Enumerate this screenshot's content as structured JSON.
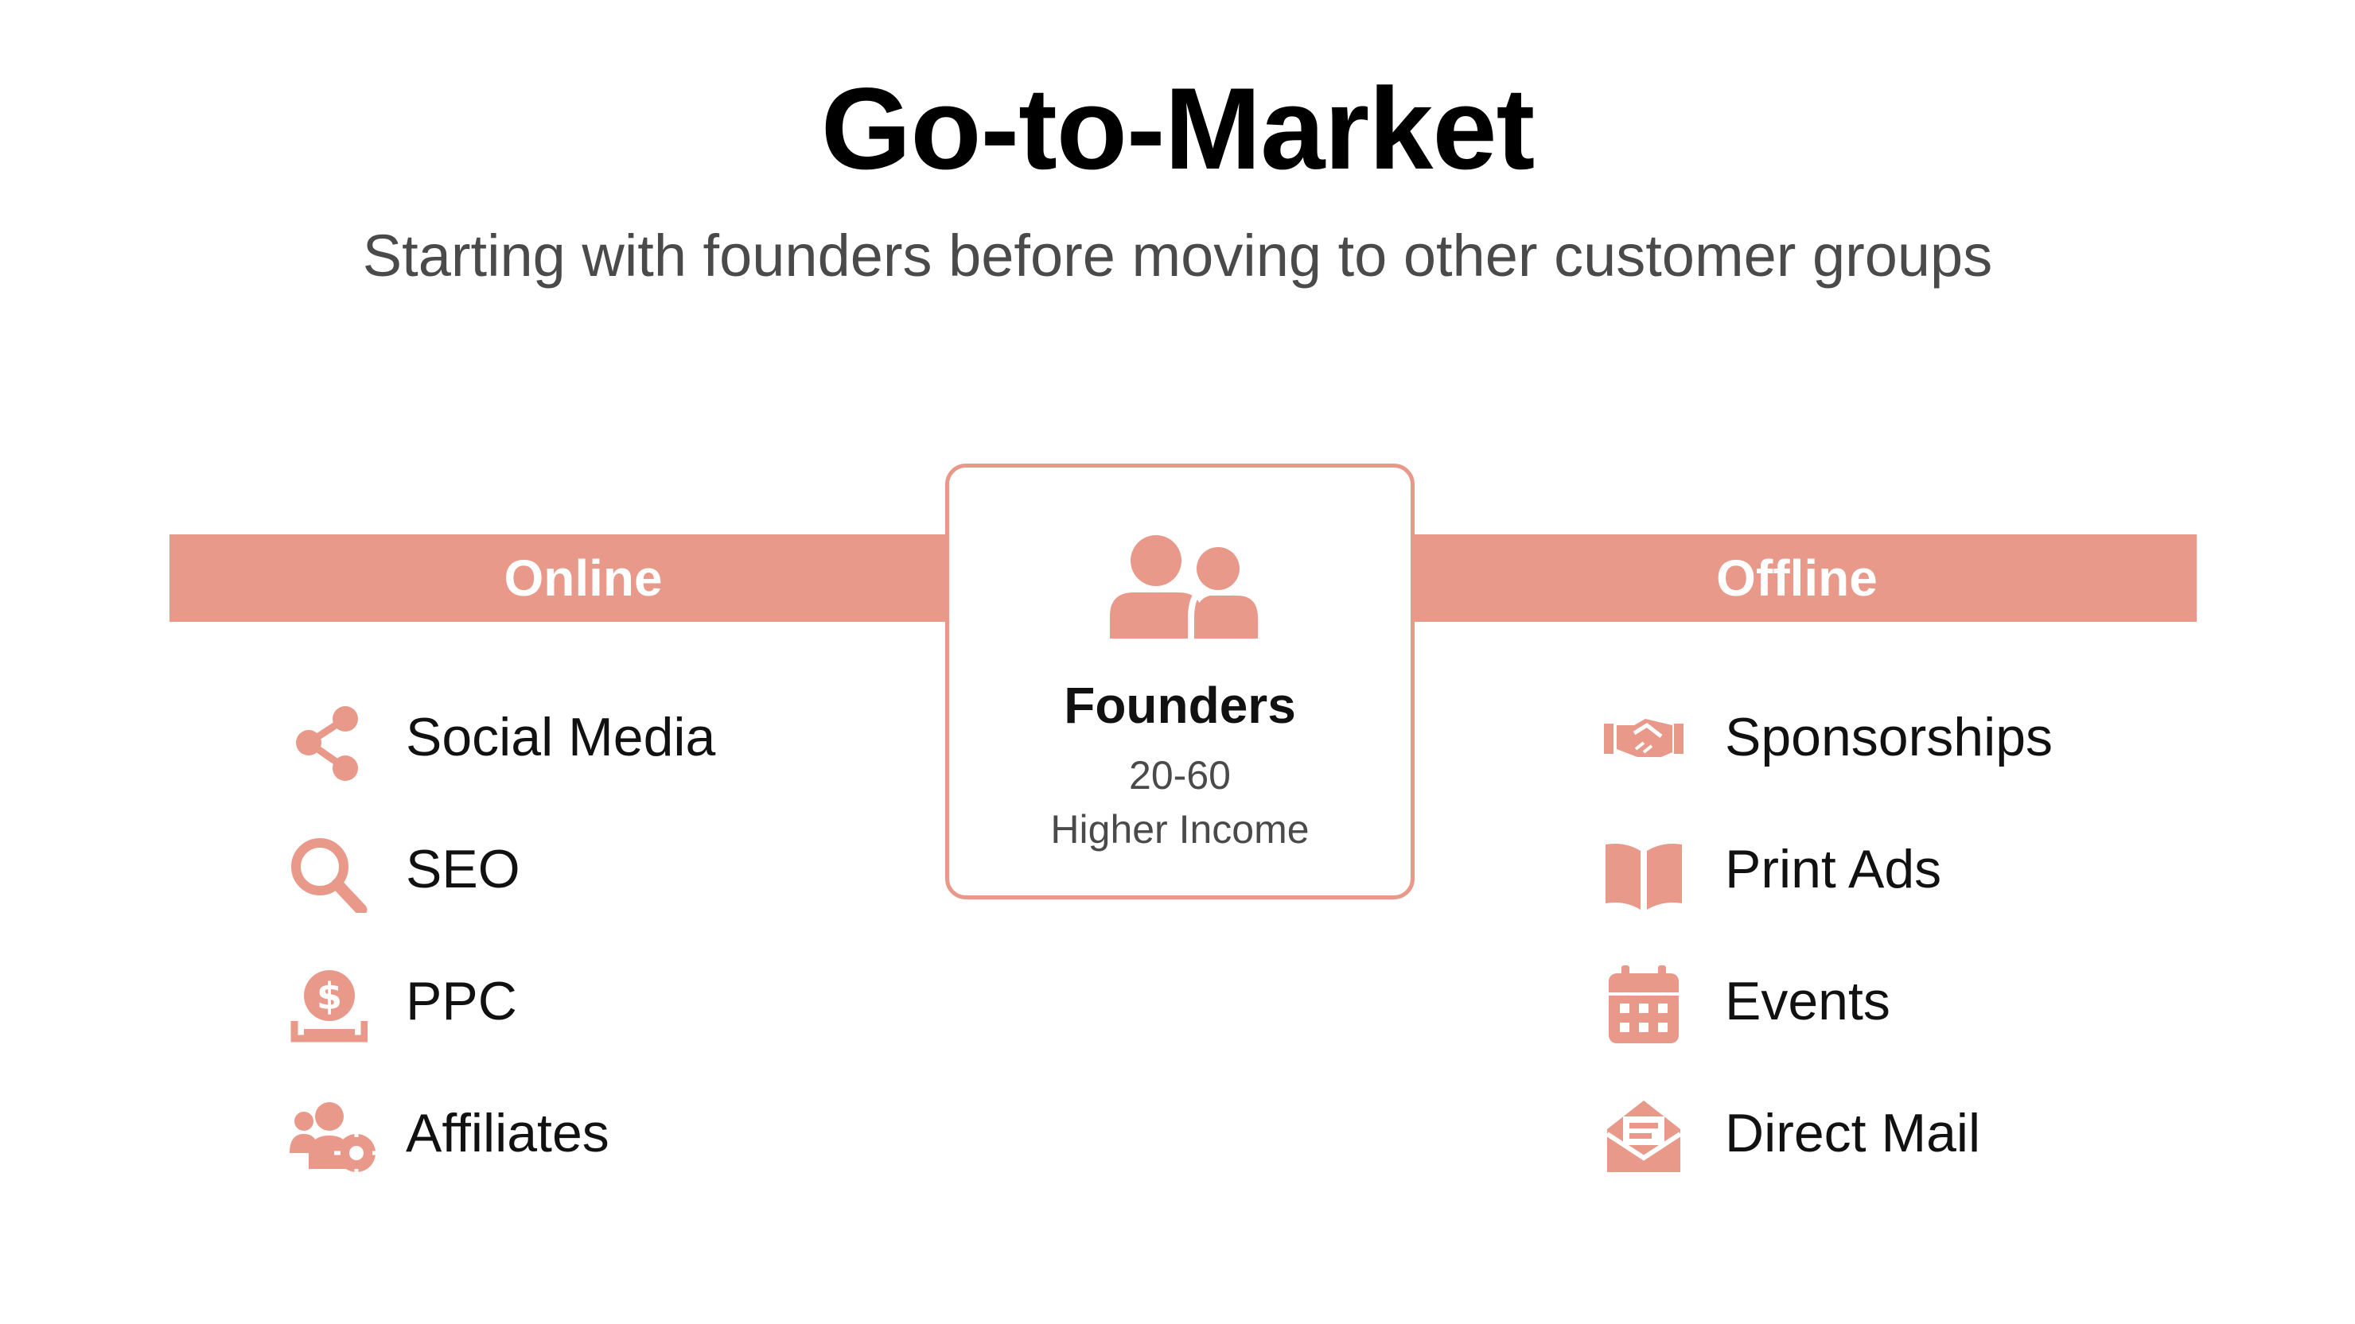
{
  "title": "Go-to-Market",
  "subtitle": "Starting with founders before moving to other customer groups",
  "colors": {
    "accent": "#e8998a",
    "text": "#111111",
    "subtext": "#4a4a4a"
  },
  "online": {
    "label": "Online",
    "items": [
      {
        "label": "Social Media",
        "icon": "share-icon"
      },
      {
        "label": "SEO",
        "icon": "search-icon"
      },
      {
        "label": "PPC",
        "icon": "dollar-coin-hand-icon"
      },
      {
        "label": "Affiliates",
        "icon": "users-gear-icon"
      }
    ]
  },
  "offline": {
    "label": "Offline",
    "items": [
      {
        "label": "Sponsorships",
        "icon": "handshake-icon"
      },
      {
        "label": "Print Ads",
        "icon": "open-book-icon"
      },
      {
        "label": "Events",
        "icon": "calendar-icon"
      },
      {
        "label": "Direct Mail",
        "icon": "envelope-open-icon"
      }
    ]
  },
  "center": {
    "title": "Founders",
    "age_range": "20-60",
    "income": "Higher Income",
    "icon": "users-icon"
  }
}
